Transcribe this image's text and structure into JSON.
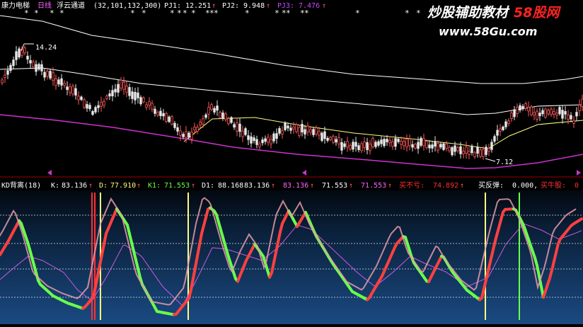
{
  "top_panel": {
    "stock_name": "康力电梯",
    "period": "日线",
    "indicator_name": "浮云通道",
    "indicator_params": "(32,101,132,300)",
    "pj1_label": "PJ1:",
    "pj1_value": "12.251",
    "pj2_label": "PJ2:",
    "pj2_value": "9.948",
    "pj3_label": "PJ3:",
    "pj3_value": "7.476",
    "arrow": "↑",
    "star": "*",
    "high_label": "14.24",
    "low_label": "7.12"
  },
  "bottom_panel": {
    "indicator_name": "KD背离(18)",
    "k_label": "K:",
    "k_value": "83.136",
    "d_label": "D:",
    "d_value": "77.910",
    "k1_label": "K1:",
    "k1_value": "71.553",
    "d1_label": "D1:",
    "d1_value": "88.168",
    "v5": "83.136",
    "v6": "83.136",
    "v7": "71.553",
    "v8": "71.553",
    "buy_no_label": "买不亏:",
    "buy_no_value": "74.892",
    "rebound_label": "买反弹:",
    "rebound_value": "0.000,",
    "bull_label": "买牛股:",
    "bull_value": "0"
  },
  "watermark": {
    "text1": "炒股辅助教材",
    "text2": "58股网",
    "url": "www.58Gu.com"
  },
  "colors": {
    "background": "#000000",
    "up": "#ff5a5a",
    "down": "#e8e8e8",
    "band": "#ffffff",
    "support": "#cc33cc",
    "k_green": "#6aff4a",
    "k_red": "#ff4040",
    "highlight": "#ffff80",
    "pink": "#ff66ff",
    "label_red": "#ff3030"
  }
}
